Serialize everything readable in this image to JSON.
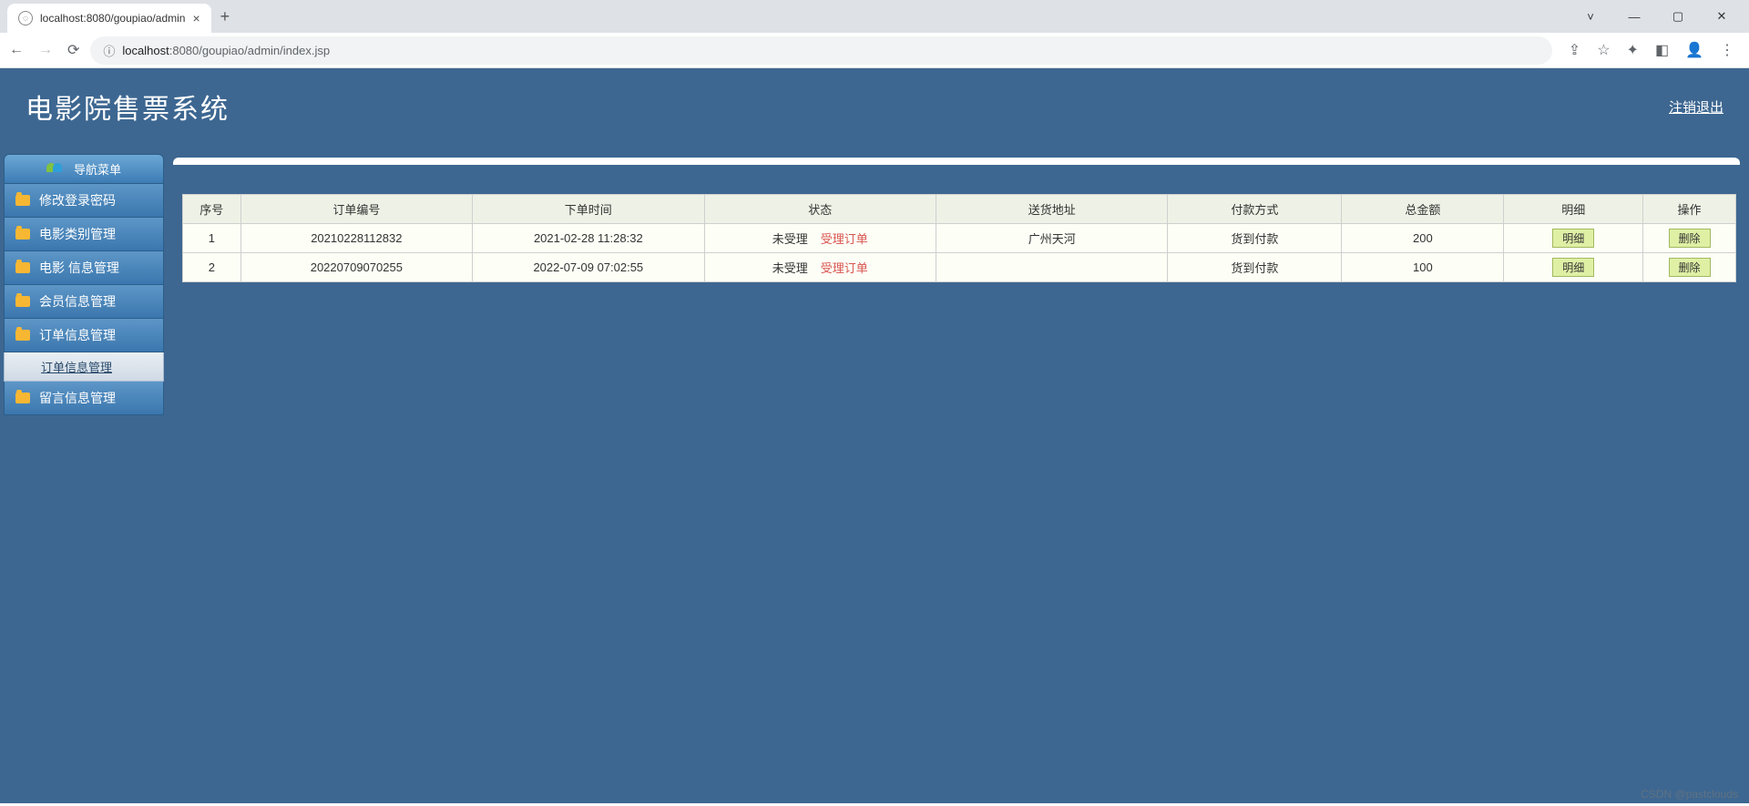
{
  "browser": {
    "tab_title": "localhost:8080/goupiao/admin",
    "url_host": "localhost",
    "url_port_path": ":8080/goupiao/admin/index.jsp"
  },
  "header": {
    "title": "电影院售票系统",
    "logout": "注销退出"
  },
  "sidebar": {
    "nav_title": "导航菜单",
    "items": [
      {
        "label": "修改登录密码"
      },
      {
        "label": "电影类别管理"
      },
      {
        "label": "电影 信息管理"
      },
      {
        "label": "会员信息管理"
      },
      {
        "label": "订单信息管理"
      },
      {
        "label": "留言信息管理"
      }
    ],
    "sub_item": "订单信息管理"
  },
  "table": {
    "headers": {
      "seq": "序号",
      "order_no": "订单编号",
      "order_time": "下单时间",
      "status": "状态",
      "address": "送货地址",
      "payment": "付款方式",
      "total": "总金额",
      "detail": "明细",
      "action": "操作"
    },
    "status_text": "未受理",
    "status_link": "受理订单",
    "detail_btn": "明细",
    "delete_btn": "删除",
    "rows": [
      {
        "seq": "1",
        "order_no": "20210228112832",
        "order_time": "2021-02-28 11:28:32",
        "address": "广州天河",
        "payment": "货到付款",
        "total": "200"
      },
      {
        "seq": "2",
        "order_no": "20220709070255",
        "order_time": "2022-07-09 07:02:55",
        "address": "",
        "payment": "货到付款",
        "total": "100"
      }
    ]
  },
  "watermark": "CSDN @pastclouds"
}
